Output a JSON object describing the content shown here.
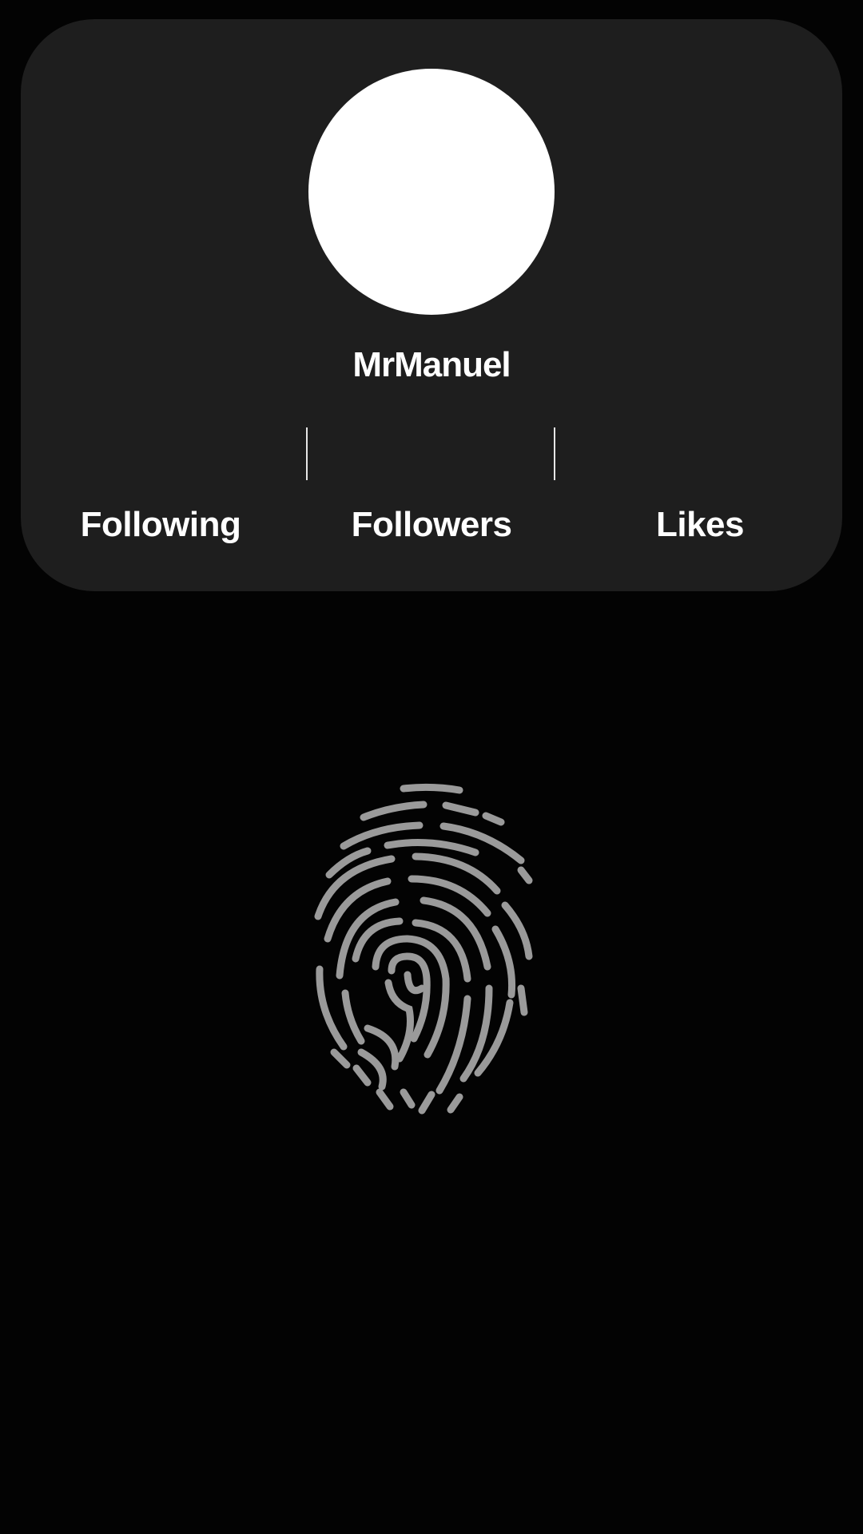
{
  "profile": {
    "username": "MrManuel",
    "stats": {
      "following_label": "Following",
      "followers_label": "Followers",
      "likes_label": "Likes"
    }
  },
  "icons": {
    "fingerprint": "fingerprint-icon"
  },
  "colors": {
    "background": "#030303",
    "card": "#1e1e1e",
    "text": "#ffffff",
    "fingerprint": "#9a9a9a"
  }
}
